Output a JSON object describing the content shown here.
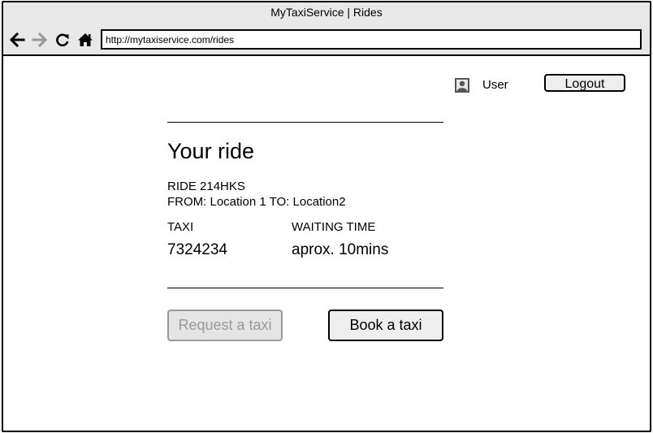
{
  "browser": {
    "window_title": "MyTaxiService | Rides",
    "url": "http://mytaxiservice.com/rides",
    "nav_icons": [
      "back-arrow-icon",
      "forward-arrow-icon",
      "reload-icon",
      "home-icon"
    ]
  },
  "header": {
    "user_icon": "user-icon",
    "user_label": "User",
    "logout_label": "Logout"
  },
  "ride": {
    "title": "Your ride",
    "ride_id": "RIDE 214HKS",
    "route": "FROM: Location 1 TO: Location2",
    "taxi_label": "TAXI",
    "taxi_value": "7324234",
    "waiting_label": "WAITING TIME",
    "waiting_value": "aprox. 10mins"
  },
  "actions": {
    "request_label": "Request a taxi",
    "book_label": "Book a taxi"
  },
  "colors": {
    "chrome_bg": "#e8e8e8",
    "button_bg": "#eeeeee",
    "disabled_text": "#999999"
  }
}
